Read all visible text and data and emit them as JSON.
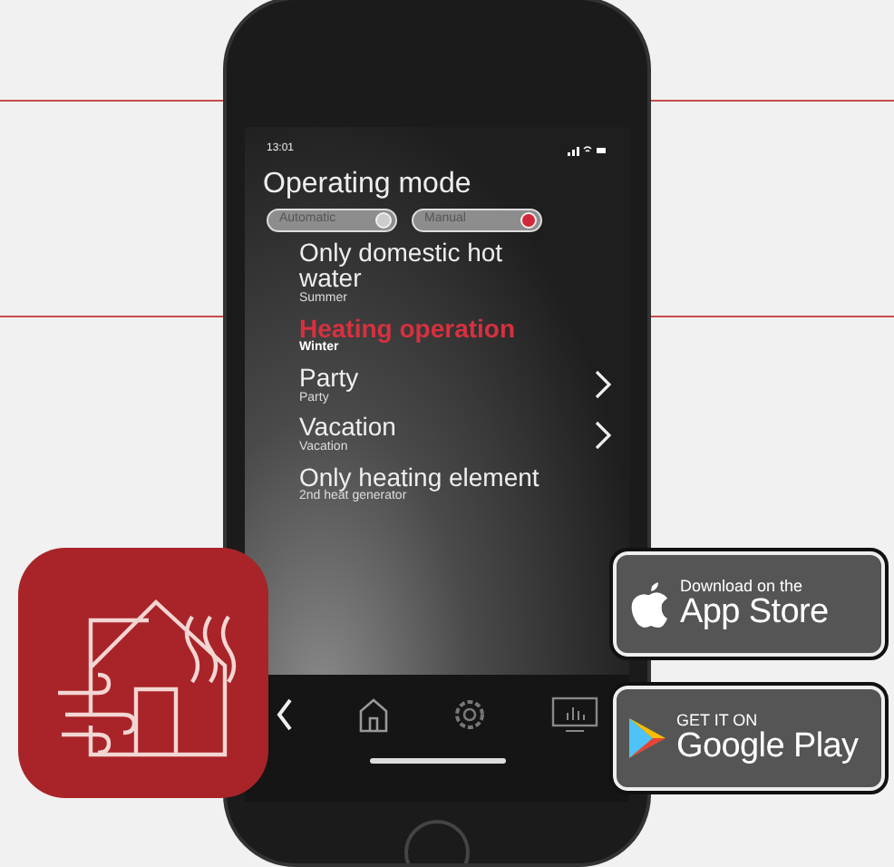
{
  "status_bar": {
    "time": "13:01"
  },
  "title": "Operating mode",
  "mode_switches": [
    {
      "label": "Automatic",
      "on": false
    },
    {
      "label": "Manual",
      "on": true
    }
  ],
  "modes": [
    {
      "label": "Only domestic hot water",
      "sublabel": "Summer",
      "selected": false,
      "has_submenu": false
    },
    {
      "label": "Heating operation",
      "sublabel": "Winter",
      "selected": true,
      "has_submenu": false
    },
    {
      "label": "Party",
      "sublabel": "Party",
      "selected": false,
      "has_submenu": true
    },
    {
      "label": "Vacation",
      "sublabel": "Vacation",
      "selected": false,
      "has_submenu": true
    },
    {
      "label": "Only heating element",
      "sublabel": "2nd heat generator",
      "selected": false,
      "has_submenu": false
    }
  ],
  "store_badges": [
    {
      "kind": "apple",
      "small": "Download on the",
      "big": "App Store"
    },
    {
      "kind": "google",
      "small": "GET IT ON",
      "big": "Google Play"
    }
  ]
}
